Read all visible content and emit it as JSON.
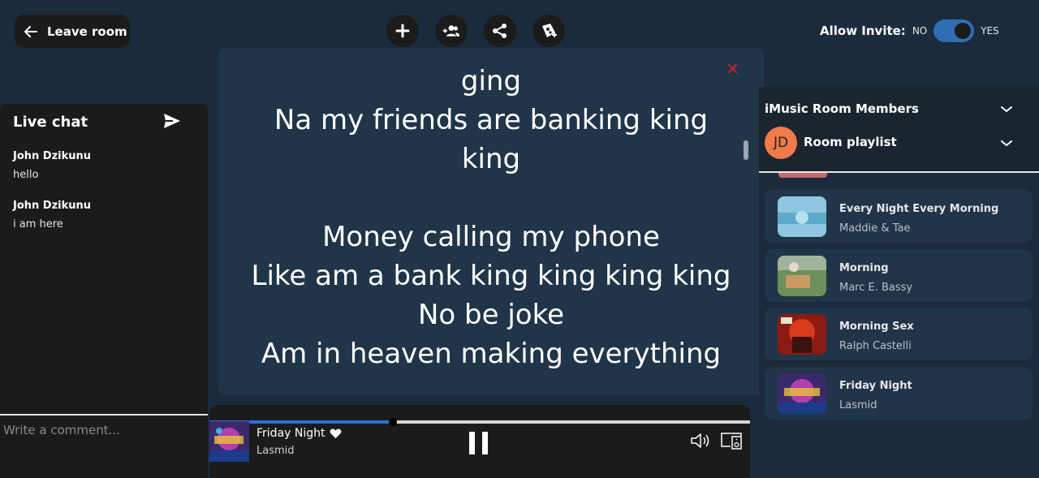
{
  "topbar": {
    "leave_label": "Leave room",
    "actions": [
      "plus-icon",
      "add-group-icon",
      "share-icon",
      "playlist-add-icon"
    ],
    "allow_invite_label": "Allow Invite:",
    "invite_no": "NO",
    "invite_yes": "YES",
    "invite_enabled": true,
    "accent": "#2f6eb3"
  },
  "lyrics": {
    "lines": [
      "ging",
      "Na my friends are banking king king",
      "",
      "Money calling my phone",
      "Like am a bank king king king king",
      "No be joke",
      "Am in heaven making everything"
    ],
    "close_glyph": "×",
    "close_color": "#d8262a"
  },
  "chat": {
    "title": "Live chat",
    "messages": [
      {
        "user": "John Dzikunu",
        "text": "hello"
      },
      {
        "user": "John Dzikunu",
        "text": "i am here"
      }
    ],
    "input_placeholder": "Write a comment..."
  },
  "player": {
    "title": "Friday Night",
    "artist": "Lasmid",
    "progress": 0.34,
    "progress_color": "#2b6fd1",
    "liked": true
  },
  "right_panel": {
    "members_title": "iMusic Room Members",
    "avatar_initials": "JD",
    "avatar_color": "#f07a4a",
    "playlist_title": "Room playlist",
    "tracks": [
      {
        "title": "Every Night Every Morning",
        "artist": "Maddie & Tae"
      },
      {
        "title": "Morning",
        "artist": "Marc E. Bassy"
      },
      {
        "title": "Morning Sex",
        "artist": "Ralph Castelli"
      },
      {
        "title": "Friday Night",
        "artist": "Lasmid"
      }
    ]
  }
}
